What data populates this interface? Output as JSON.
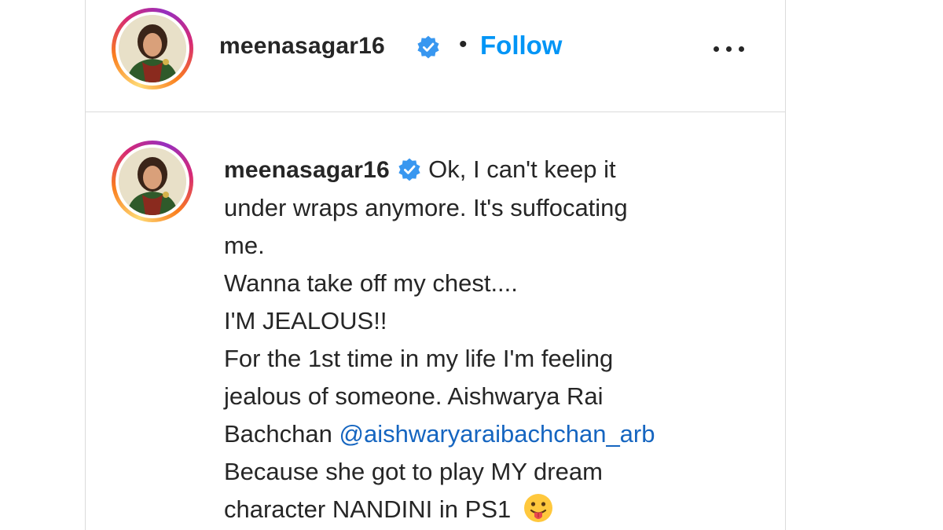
{
  "header": {
    "username": "meenasagar16",
    "separator": "•",
    "follow_label": "Follow",
    "more_icon": "more-options-icon"
  },
  "caption": {
    "username": "meenasagar16",
    "lines": [
      "Ok, I can't keep it",
      "under wraps anymore. It's suffocating",
      "me.",
      "Wanna take off my chest....",
      "I'M JEALOUS!!",
      "For the 1st time in my life I'm feeling",
      "jealous of someone. Aishwarya Rai",
      "Bachchan",
      "Because she got to play MY dream",
      "character NANDINI in PS1"
    ],
    "mention": "@aishwaryaraibachchan_arb",
    "emoji": "tongue-out-face-emoji"
  },
  "colors": {
    "accent": "#0095f6",
    "text": "#262626",
    "mention": "#1565c0",
    "border": "#dbdbdb"
  }
}
